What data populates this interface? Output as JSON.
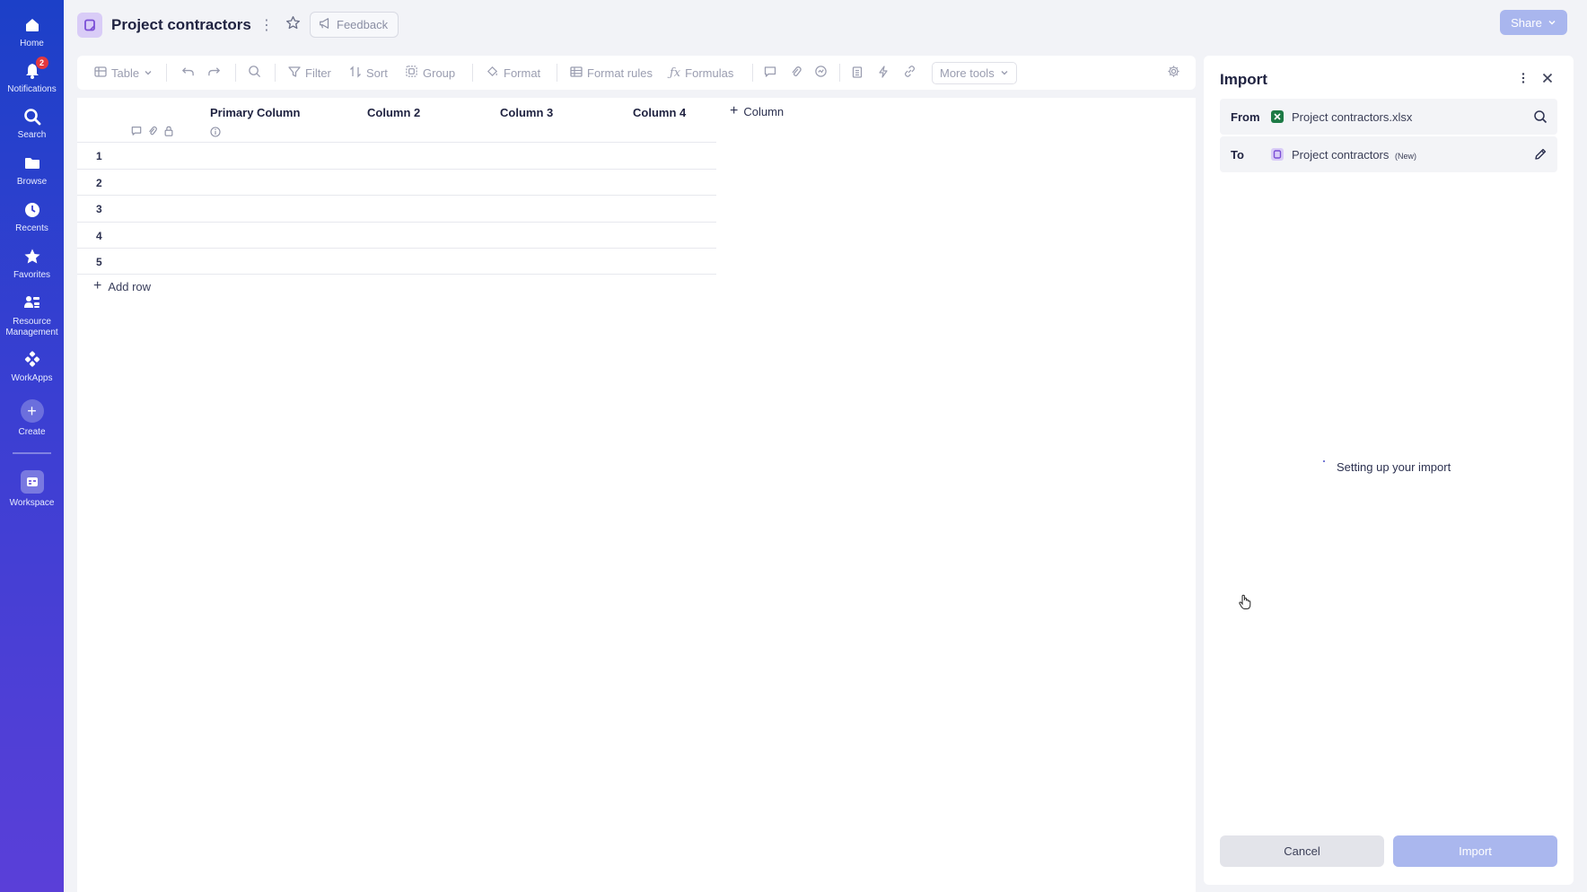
{
  "nav": {
    "home": "Home",
    "notifications": "Notifications",
    "notifications_count": "2",
    "search": "Search",
    "browse": "Browse",
    "recents": "Recents",
    "favorites": "Favorites",
    "resource_line1": "Resource",
    "resource_line2": "Management",
    "workapps": "WorkApps",
    "create": "Create",
    "workspace": "Workspace"
  },
  "header": {
    "title": "Project contractors",
    "feedback": "Feedback",
    "share": "Share"
  },
  "toolbar": {
    "table": "Table",
    "filter": "Filter",
    "sort": "Sort",
    "group": "Group",
    "format": "Format",
    "format_rules": "Format rules",
    "formulas": "Formulas",
    "more_tools": "More tools"
  },
  "grid": {
    "columns": [
      "Primary Column",
      "Column 2",
      "Column 3",
      "Column 4"
    ],
    "add_column": "Column",
    "rows": [
      "1",
      "2",
      "3",
      "4",
      "5"
    ],
    "add_row": "Add row"
  },
  "import_panel": {
    "title": "Import",
    "from_label": "From",
    "from_value": "Project contractors.xlsx",
    "to_label": "To",
    "to_value": "Project contractors",
    "to_tag": "(New)",
    "status": "Setting up your import",
    "cancel": "Cancel",
    "import": "Import"
  },
  "colors": {
    "nav_top": "#1c40c8",
    "nav_bottom": "#5a3fd8",
    "primary_disabled": "#aab7ee",
    "excel_green": "#1d7a45",
    "sheet_purple": "#7b4fd6"
  }
}
